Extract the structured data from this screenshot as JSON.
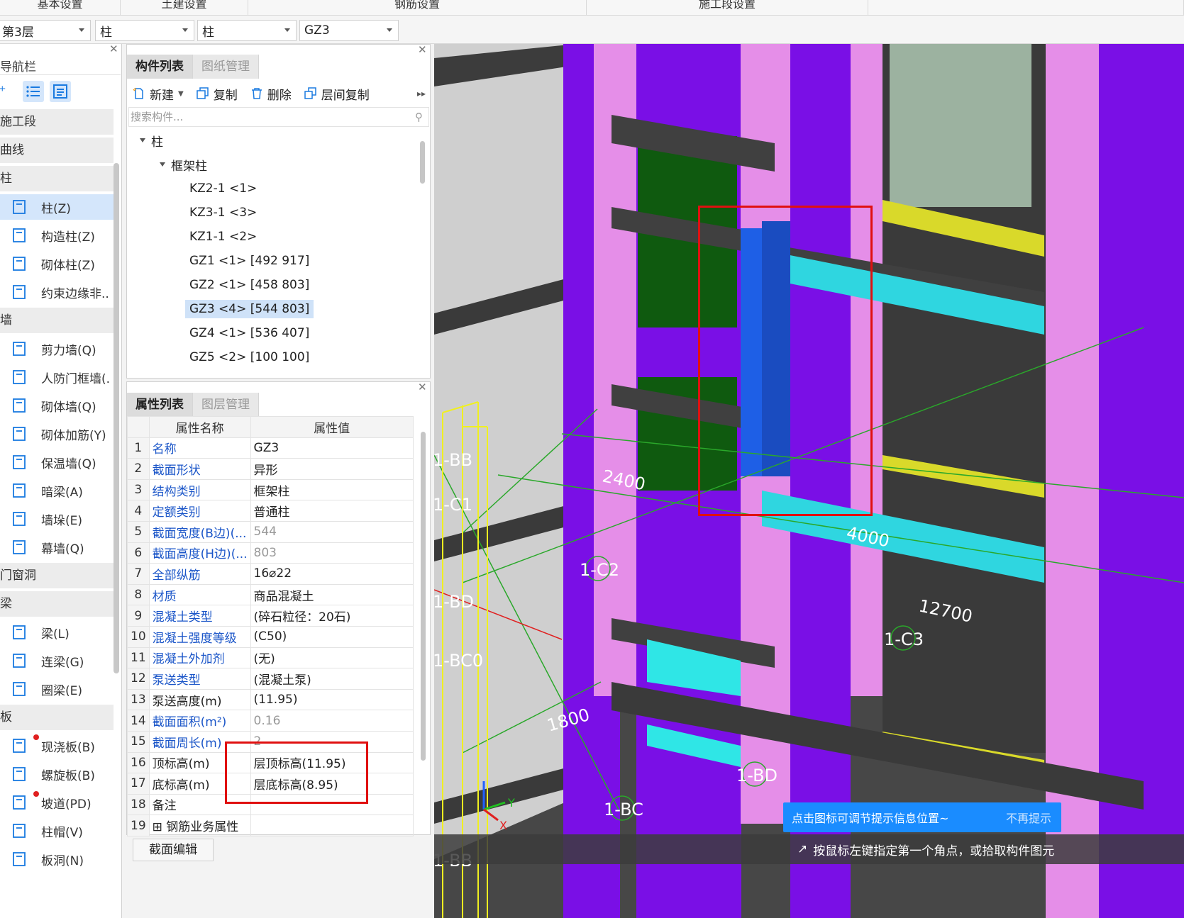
{
  "top_tabs": [
    {
      "label": "基本设置",
      "width": 170
    },
    {
      "label": "土建设置",
      "width": 180
    },
    {
      "label": "钢筋设置",
      "width": 477
    },
    {
      "label": "施工段设置",
      "width": 397
    },
    {
      "label": "",
      "width": 445
    }
  ],
  "selectors": [
    {
      "value": "第3层"
    },
    {
      "value": "柱"
    },
    {
      "value": "柱"
    },
    {
      "value": "GZ3"
    }
  ],
  "nav": {
    "title": "导航栏",
    "items": [
      {
        "type": "cat",
        "label": "施工段"
      },
      {
        "type": "cat",
        "label": "曲线"
      },
      {
        "type": "cat",
        "label": "柱"
      },
      {
        "type": "item",
        "label": "柱(Z)",
        "active": true,
        "icon": "column-icon"
      },
      {
        "type": "item",
        "label": "构造柱(Z)",
        "icon": "construct-column-icon"
      },
      {
        "type": "item",
        "label": "砌体柱(Z)",
        "icon": "masonry-column-icon"
      },
      {
        "type": "item",
        "label": "约束边缘非..",
        "icon": "edge-constraint-icon"
      },
      {
        "type": "cat",
        "label": "墙"
      },
      {
        "type": "item",
        "label": "剪力墙(Q)",
        "icon": "shear-wall-icon"
      },
      {
        "type": "item",
        "label": "人防门框墙(.",
        "icon": "civil-defense-wall-icon"
      },
      {
        "type": "item",
        "label": "砌体墙(Q)",
        "icon": "masonry-wall-icon"
      },
      {
        "type": "item",
        "label": "砌体加筋(Y)",
        "icon": "masonry-rebar-icon"
      },
      {
        "type": "item",
        "label": "保温墙(Q)",
        "icon": "insulation-wall-icon"
      },
      {
        "type": "item",
        "label": "暗梁(A)",
        "icon": "hidden-beam-icon"
      },
      {
        "type": "item",
        "label": "墙垛(E)",
        "icon": "wall-pier-icon"
      },
      {
        "type": "item",
        "label": "幕墙(Q)",
        "icon": "curtain-wall-icon"
      },
      {
        "type": "cat",
        "label": "门窗洞"
      },
      {
        "type": "cat",
        "label": "梁"
      },
      {
        "type": "item",
        "label": "梁(L)",
        "icon": "beam-icon"
      },
      {
        "type": "item",
        "label": "连梁(G)",
        "icon": "coupling-beam-icon"
      },
      {
        "type": "item",
        "label": "圈梁(E)",
        "icon": "ring-beam-icon"
      },
      {
        "type": "cat",
        "label": "板"
      },
      {
        "type": "item",
        "label": "现浇板(B)",
        "icon": "slab-icon",
        "dot": true
      },
      {
        "type": "item",
        "label": "螺旋板(B)",
        "icon": "spiral-slab-icon"
      },
      {
        "type": "item",
        "label": "坡道(PD)",
        "icon": "ramp-icon",
        "dot": true
      },
      {
        "type": "item",
        "label": "柱帽(V)",
        "icon": "column-cap-icon"
      },
      {
        "type": "item",
        "label": "板洞(N)",
        "icon": "slab-hole-icon"
      }
    ]
  },
  "component_panel": {
    "tabs": [
      "构件列表",
      "图纸管理"
    ],
    "toolbar": {
      "new": "新建",
      "copy": "复制",
      "delete": "删除",
      "floor_copy": "层间复制"
    },
    "search_placeholder": "搜索构件...",
    "tree": [
      {
        "level": 0,
        "label": "柱",
        "expanded": true
      },
      {
        "level": 1,
        "label": "框架柱",
        "expanded": true
      },
      {
        "level": 2,
        "label": "KZ2-1 <1>"
      },
      {
        "level": 2,
        "label": "KZ3-1 <3>"
      },
      {
        "level": 2,
        "label": "KZ1-1 <2>"
      },
      {
        "level": 2,
        "label": "GZ1 <1> [492 917]"
      },
      {
        "level": 2,
        "label": "GZ2 <1> [458 803]"
      },
      {
        "level": 2,
        "label": "GZ3 <4> [544 803]",
        "selected": true
      },
      {
        "level": 2,
        "label": "GZ4 <1> [536 407]"
      },
      {
        "level": 2,
        "label": "GZ5 <2> [100 100]"
      }
    ]
  },
  "property_panel": {
    "tabs": [
      "属性列表",
      "图层管理"
    ],
    "headers": [
      "属性名称",
      "属性值"
    ],
    "rows": [
      {
        "num": "1",
        "name": "名称",
        "value": "GZ3",
        "link": true
      },
      {
        "num": "2",
        "name": "截面形状",
        "value": "异形",
        "link": true
      },
      {
        "num": "3",
        "name": "结构类别",
        "value": "框架柱",
        "link": true
      },
      {
        "num": "4",
        "name": "定额类别",
        "value": "普通柱",
        "link": true
      },
      {
        "num": "5",
        "name": "截面宽度(B边)(...",
        "value": "544",
        "link": true,
        "gray": true
      },
      {
        "num": "6",
        "name": "截面高度(H边)(...",
        "value": "803",
        "link": true,
        "gray": true
      },
      {
        "num": "7",
        "name": "全部纵筋",
        "value": "16⌀22",
        "link": true
      },
      {
        "num": "8",
        "name": "材质",
        "value": "商品混凝土",
        "link": true
      },
      {
        "num": "9",
        "name": "混凝土类型",
        "value": "(碎石粒径：20石)",
        "link": true
      },
      {
        "num": "10",
        "name": "混凝土强度等级",
        "value": "(C50)",
        "link": true
      },
      {
        "num": "11",
        "name": "混凝土外加剂",
        "value": "(无)",
        "link": true
      },
      {
        "num": "12",
        "name": "泵送类型",
        "value": "(混凝土泵)",
        "link": true
      },
      {
        "num": "13",
        "name": "泵送高度(m)",
        "value": "(11.95)",
        "link": false
      },
      {
        "num": "14",
        "name": "截面面积(m²)",
        "value": "0.16",
        "link": true,
        "gray": true
      },
      {
        "num": "15",
        "name": "截面周长(m)",
        "value": "2",
        "link": true,
        "gray": true
      },
      {
        "num": "16",
        "name": "顶标高(m)",
        "value": "层顶标高(11.95)",
        "link": false
      },
      {
        "num": "17",
        "name": "底标高(m)",
        "value": "层底标高(8.95)",
        "link": false
      },
      {
        "num": "18",
        "name": "备注",
        "value": "",
        "link": false
      },
      {
        "num": "19",
        "name": "⊞ 钢筋业务属性",
        "value": "",
        "link": false
      }
    ],
    "edit_button": "截面编辑"
  },
  "viewport": {
    "dim_labels": [
      "2400",
      "4000",
      "12700",
      "1800"
    ],
    "axis_labels": [
      "1-C2",
      "1-C3",
      "1-BD",
      "1-BC"
    ],
    "partial_axis_labels": [
      "1-BB",
      "1-C1",
      "1-BD",
      "1-BC0",
      "1-BB"
    ],
    "tip": "点击图标可调节提示信息位置~",
    "tip_dismiss": "不再提示",
    "status": "按鼠标左键指定第一个角点，或拾取构件图元",
    "colors": {
      "purple": "#7a0fe6",
      "pink": "#e58ee8",
      "slab": "#3c3c3c",
      "cyan": "#2fd6e0",
      "blue": "#1e5fe6",
      "yellow": "#d9d92a",
      "green": "#0f5a0f",
      "sage": "#9cb2a0"
    }
  }
}
